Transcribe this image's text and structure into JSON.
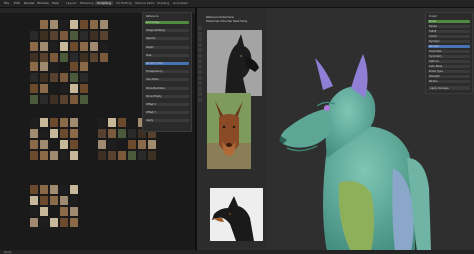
{
  "menu": [
    "File",
    "Edit",
    "Render",
    "Window",
    "Help"
  ],
  "workspace_tabs": [
    "Layout",
    "Modeling",
    "Sculpting",
    "UV Editing",
    "Texture Paint",
    "Shading",
    "Animation"
  ],
  "active_tab": "Sculpting",
  "left_panel": {
    "title": "Reference",
    "rows": [
      "Add Image",
      "Image Settings",
      "Opacity",
      "Depth",
      "Side",
      "Show In Front",
      "Transparency",
      "Use Alpha",
      "Show Backface",
      "Show Empty",
      "Offset X",
      "Offset Y",
      "Apply"
    ]
  },
  "reference_caption": {
    "line1": "Reference Dobermann",
    "line2": "Dobermann Pinscher Head Study"
  },
  "right_panel": {
    "title": "Sculpt",
    "rows": [
      "Brush",
      "Stroke",
      "Falloff",
      "Cursor",
      "Dyntopo",
      "Remesh",
      "Voxel Size",
      "Symmetry",
      "Options",
      "Auto-Mask",
      "Brush Type",
      "Strength",
      "Radius"
    ],
    "button": "Apply Changes"
  },
  "status": "Ready",
  "colors": {
    "accent_green": "#4f8a3f",
    "accent_blue": "#4772b3",
    "sculpt_teal": "#5fae9e",
    "ear_violet": "#8f80d6",
    "body_olive": "#8fb05a"
  }
}
